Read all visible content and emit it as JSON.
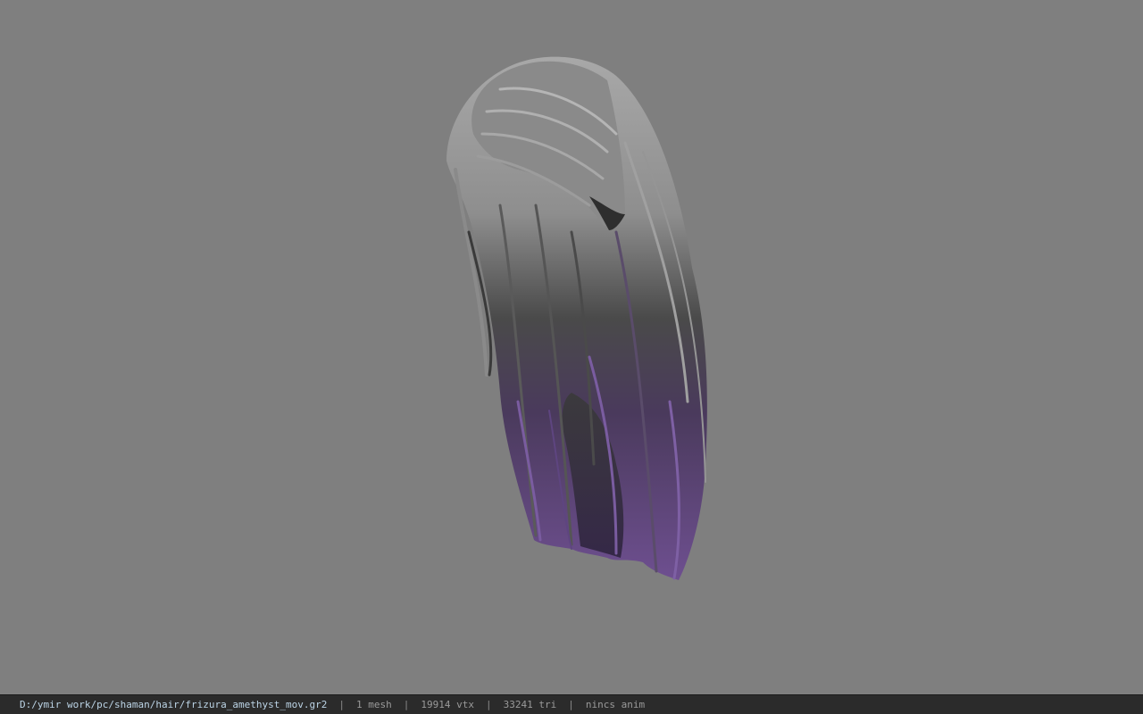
{
  "viewport": {
    "background_color": "#7f7f7f",
    "model": {
      "kind": "hair-mesh",
      "colors": {
        "top": "#9a9a9a",
        "middle": "#4c4c4c",
        "tips": "#6e4f90"
      }
    }
  },
  "statusbar": {
    "file_path": "D:/ymir work/pc/shaman/hair/frizura_amethyst_mov.gr2",
    "separator": "|",
    "mesh_count": "1 mesh",
    "vertex_count": "19914 vtx",
    "triangle_count": "33241 tri",
    "anim_status": "nincs anim"
  }
}
